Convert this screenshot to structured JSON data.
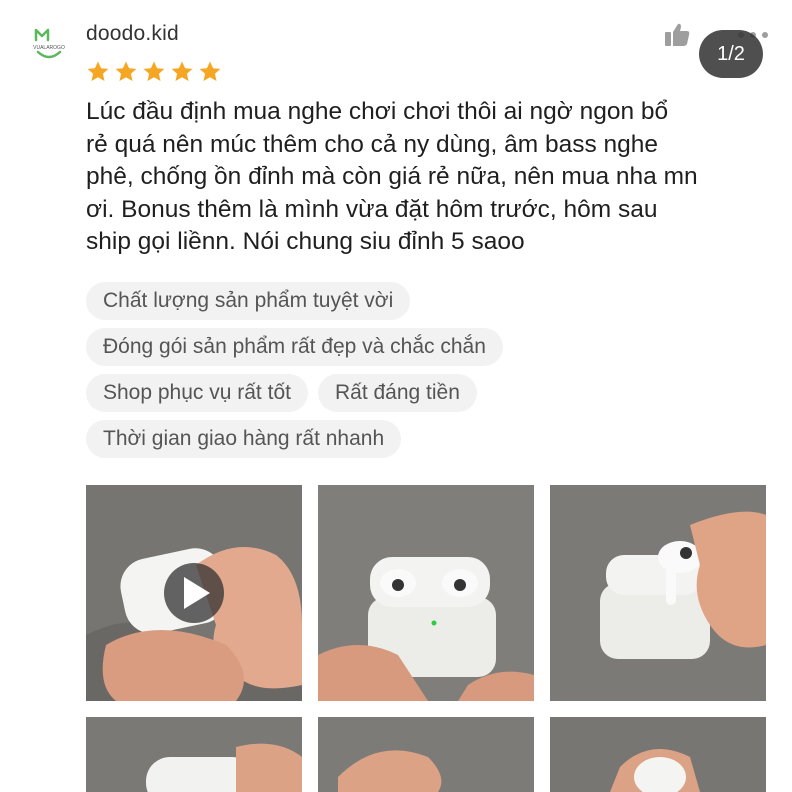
{
  "review": {
    "username": "doodo.kid",
    "avatar_icon": "vualarogo-logo",
    "avatar_text": "VUALAROGO",
    "rating": 5,
    "stars": [
      1,
      2,
      3,
      4,
      5
    ],
    "star_color": "#f5a623",
    "text_lines": [
      "Lúc đầu định mua nghe chơi chơi thôi ai ngờ ngon bổ",
      "rẻ quá nên múc thêm cho cả ny dùng, âm bass nghe",
      "phê, chống ồn đỉnh mà còn giá rẻ nữa, nên mua nha mn",
      "ơi. Bonus thêm là mình vừa đặt hôm trước, hôm sau",
      "ship gọi liềnn. Nói chung siu đỉnh 5 saoo"
    ]
  },
  "header": {
    "like_icon": "thumbs-up-icon",
    "more_icon": "more-dots-icon",
    "counter": "1/2"
  },
  "tags": [
    [
      "Chất lượng sản phẩm tuyệt vời"
    ],
    [
      "Đóng gói sản phẩm rất đẹp và chắc chắn"
    ],
    [
      "Shop phục vụ rất tốt",
      "Rất đáng tiền"
    ],
    [
      "Thời gian giao hàng rất nhanh"
    ]
  ],
  "media": {
    "items": [
      {
        "kind": "video",
        "description": "airpods case in hand"
      },
      {
        "kind": "image",
        "description": "open airpods pro case"
      },
      {
        "kind": "image",
        "description": "removing earbud from case"
      },
      {
        "kind": "image",
        "description": "case in hand"
      },
      {
        "kind": "image",
        "description": "hand"
      },
      {
        "kind": "image",
        "description": "earbud"
      }
    ],
    "play_icon": "play-icon"
  }
}
